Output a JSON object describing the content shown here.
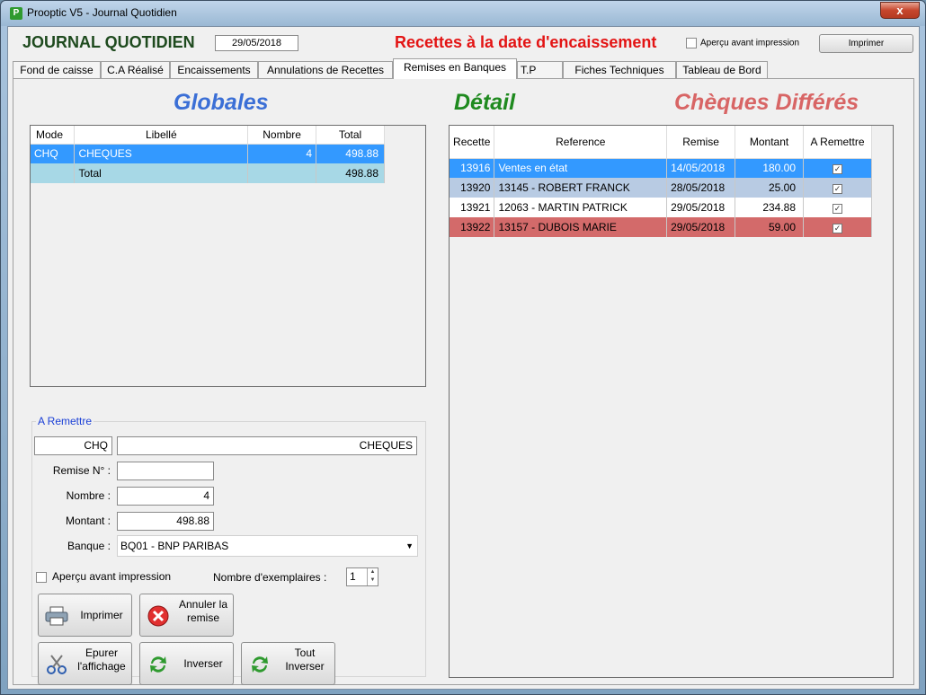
{
  "window": {
    "title": "Prooptic V5 - Journal Quotidien",
    "close_label": "x"
  },
  "header": {
    "heading": "JOURNAL QUOTIDIEN",
    "date": "29/05/2018",
    "recettes_title": "Recettes à la date d'encaissement",
    "apercu_label": "Aperçu avant impression",
    "print_label": "Imprimer"
  },
  "tabs": [
    "Fond de caisse",
    "C.A Réalisé",
    "Encaissements",
    "Annulations de Recettes",
    "Remises en Banques",
    "T.P",
    "Fiches Techniques",
    "Tableau de Bord"
  ],
  "active_tab": "Remises en Banques",
  "globales": {
    "title": "Globales",
    "columns": [
      "Mode",
      "Libellé",
      "Nombre",
      "Total"
    ],
    "rows": [
      {
        "mode": "CHQ",
        "libelle": "CHEQUES",
        "nombre": "4",
        "total": "498.88"
      },
      {
        "mode": "",
        "libelle": "Total",
        "nombre": "",
        "total": "498.88"
      }
    ]
  },
  "detail": {
    "title": "Détail",
    "cheques_title": "Chèques Différés",
    "columns": [
      "Recette",
      "Reference",
      "Remise",
      "Montant",
      "A Remettre"
    ],
    "rows": [
      {
        "recette": "13916",
        "reference": "Ventes en état",
        "remise": "14/05/2018",
        "montant": "180.00",
        "a_remettre": true
      },
      {
        "recette": "13920",
        "reference": "13145 - ROBERT FRANCK",
        "remise": "28/05/2018",
        "montant": "25.00",
        "a_remettre": true
      },
      {
        "recette": "13921",
        "reference": "12063 - MARTIN PATRICK",
        "remise": "29/05/2018",
        "montant": "234.88",
        "a_remettre": true
      },
      {
        "recette": "13922",
        "reference": "13157 - DUBOIS MARIE",
        "remise": "29/05/2018",
        "montant": "59.00",
        "a_remettre": true
      }
    ],
    "check_glyph": "✓"
  },
  "a_remettre": {
    "legend": "A Remettre",
    "mode_code": "CHQ",
    "mode_label": "CHEQUES",
    "remise_label": "Remise N° :",
    "remise_value": "",
    "nombre_label": "Nombre :",
    "nombre_value": "4",
    "montant_label": "Montant :",
    "montant_value": "498.88",
    "banque_label": "Banque :",
    "banque_value": "BQ01 - BNP PARIBAS",
    "apercu_label": "Aperçu avant impression",
    "exemplaires_label": "Nombre d'exemplaires :",
    "exemplaires_value": "1",
    "buttons": {
      "imprimer": "Imprimer",
      "annuler_l1": "Annuler la",
      "annuler_l2": "remise",
      "epurer_l1": "Epurer",
      "epurer_l2": "l'affichage",
      "inverser": "Inverser",
      "tout_l1": "Tout",
      "tout_l2": "Inverser"
    }
  },
  "colors": {
    "heading_green": "#1e4a1e",
    "recettes_red": "#e31414",
    "globales_blue": "#3b6fd6",
    "detail_green": "#1f8a1f",
    "cheques_red": "#d86565",
    "row_selected": "#3399ff",
    "row_total": "#a7d8e6",
    "row_red": "#d36a6a"
  }
}
